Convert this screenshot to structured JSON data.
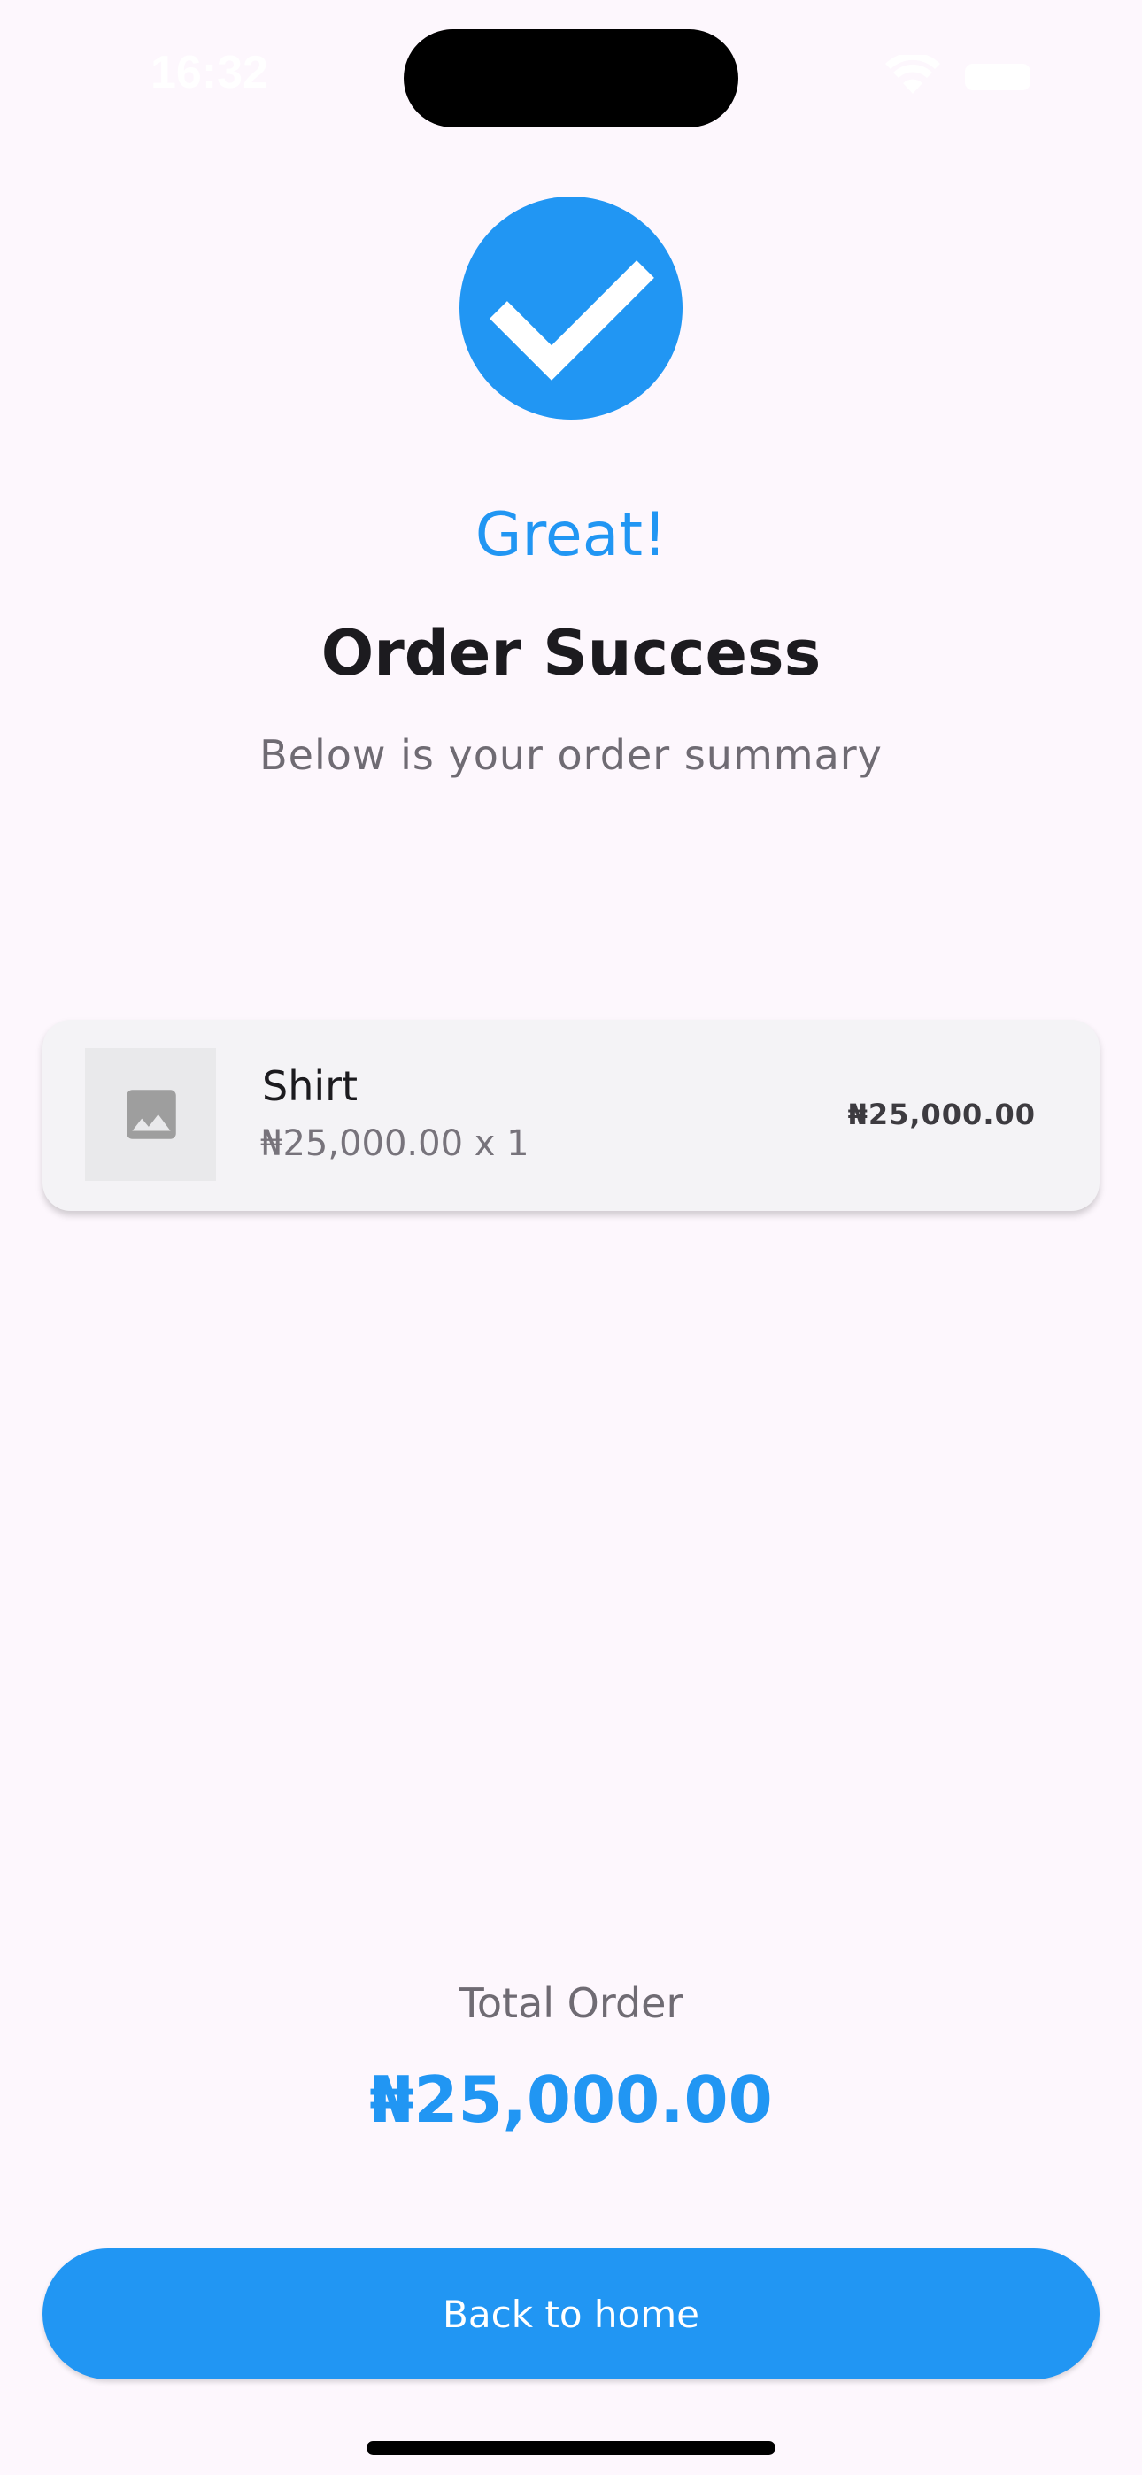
{
  "status_bar": {
    "time": "16:32"
  },
  "icons": {
    "success": "check-circle-icon",
    "item_image": "image-placeholder-icon",
    "wifi": "wifi-icon",
    "battery": "battery-icon"
  },
  "colors": {
    "accent": "#2196f3",
    "background": "#fdf7fd",
    "card": "#f4f3f6",
    "title": "#1c1b1f",
    "muted": "#6f6b73"
  },
  "header": {
    "great": "Great!",
    "title": "Order Success",
    "subtitle": "Below is your order summary"
  },
  "order": {
    "items": [
      {
        "name": "Shirt",
        "price_qty": "₦25,000.00 x 1",
        "line_total": "₦25,000.00"
      }
    ]
  },
  "summary": {
    "total_label": "Total Order",
    "total_value": "₦25,000.00"
  },
  "actions": {
    "back_home": "Back to home"
  }
}
